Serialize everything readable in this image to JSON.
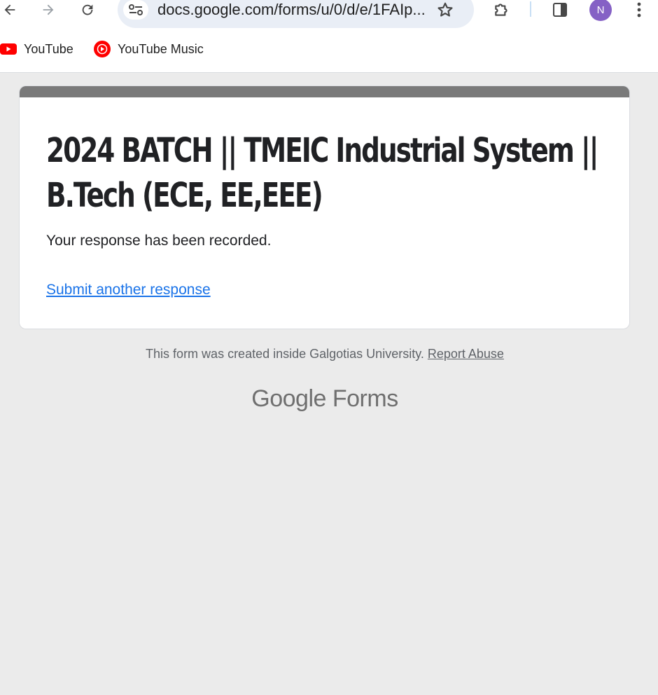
{
  "browser": {
    "url": "docs.google.com/forms/u/0/d/e/1FAIp...",
    "profile_initial": "N",
    "accent": "#8561c5"
  },
  "bookmarks": [
    {
      "label": "YouTube",
      "icon": "youtube-icon"
    },
    {
      "label": "YouTube Music",
      "icon": "youtube-music-icon"
    }
  ],
  "form": {
    "title": "2024 BATCH || TMEIC Industrial System || B.Tech (ECE, EE,EEE)",
    "message": "Your response has been recorded.",
    "another_link": "Submit another response",
    "header_color": "#7a7a7a"
  },
  "footer": {
    "note": "This form was created inside Galgotias University.",
    "report_link": "Report Abuse",
    "brand_google": "Google",
    "brand_forms": "Forms"
  }
}
